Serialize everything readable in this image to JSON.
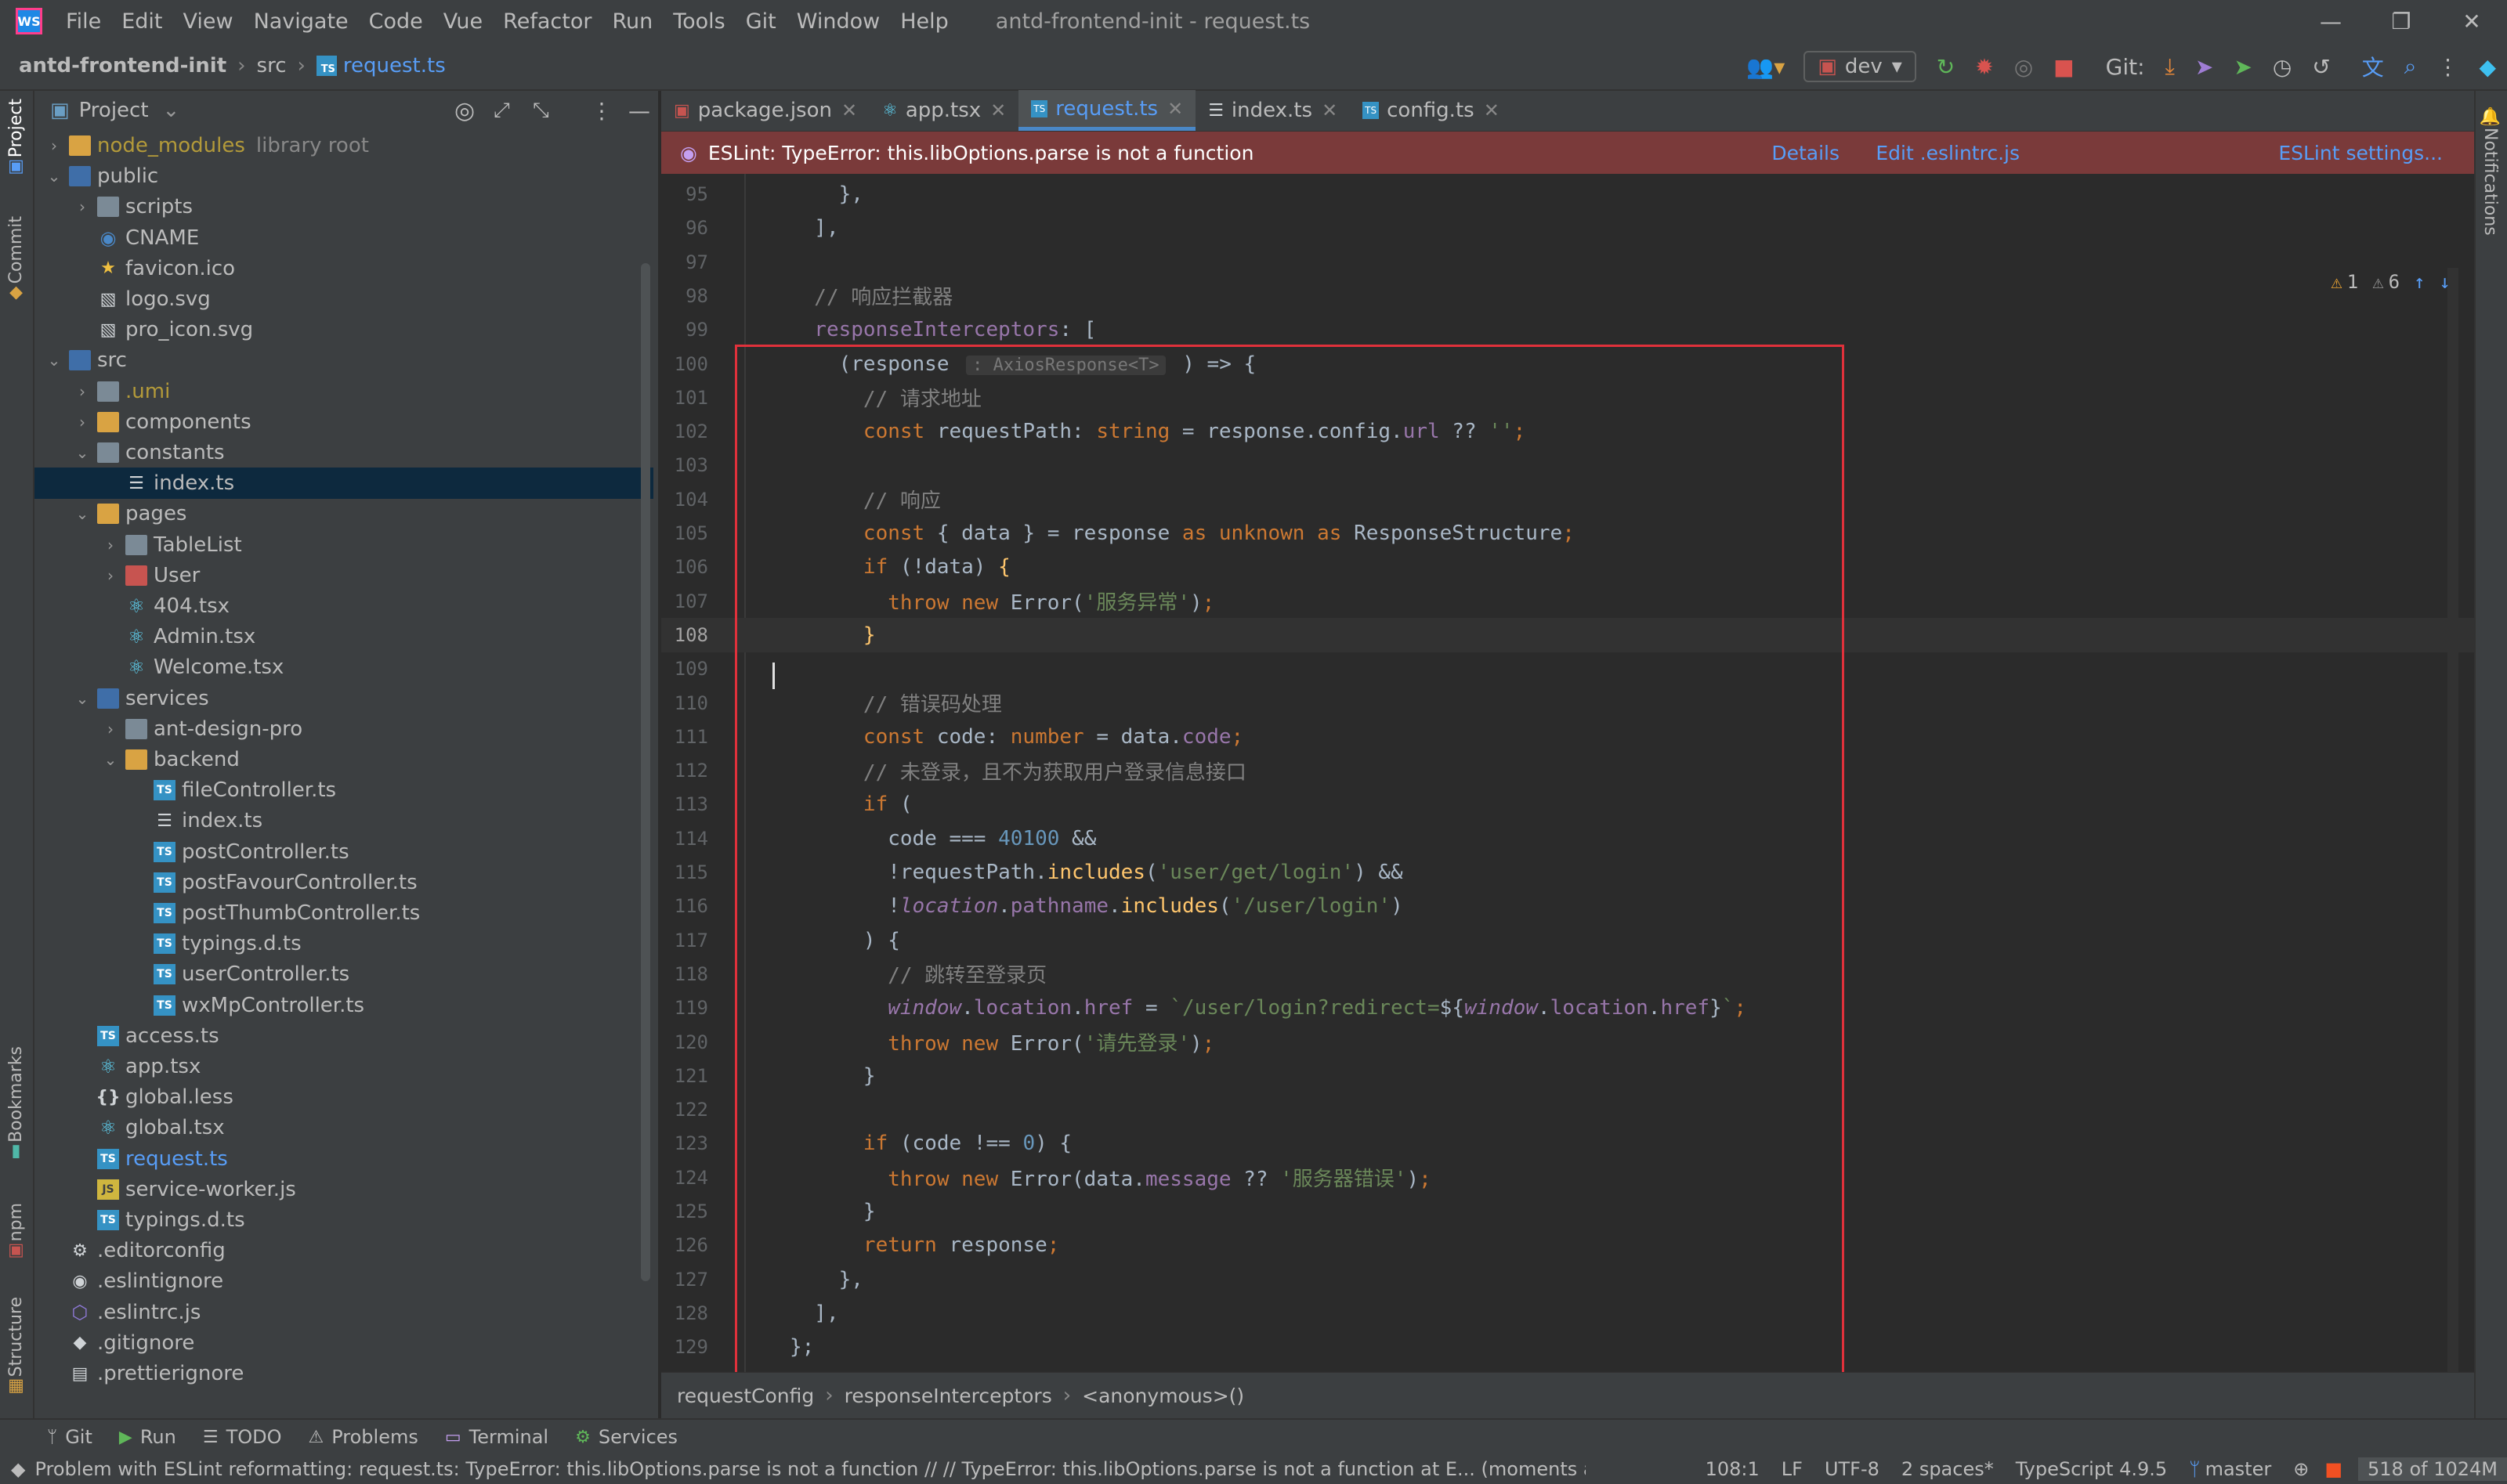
{
  "window": {
    "title": "antd-frontend-init - request.ts",
    "menu": [
      "File",
      "Edit",
      "View",
      "Navigate",
      "Code",
      "Vue",
      "Refactor",
      "Run",
      "Tools",
      "Git",
      "Window",
      "Help"
    ],
    "app_logo": "WS",
    "min": "—",
    "restore": "❐",
    "close": "✕"
  },
  "nav": {
    "crumbs": [
      "antd-frontend-init",
      "src",
      "request.ts"
    ],
    "branch": "dev",
    "git_label": "Git:"
  },
  "tool_strip": {
    "left": [
      "Project",
      "Commit",
      "Bookmarks",
      "npm",
      "Structure"
    ],
    "right": [
      "Notifications"
    ]
  },
  "project": {
    "title": "Project",
    "tree": [
      {
        "d": 1,
        "arrow": "›",
        "icon": "folder-yellow",
        "label": "node_modules",
        "extra": "library root",
        "style": "muted"
      },
      {
        "d": 1,
        "arrow": "⌄",
        "icon": "folder-blue",
        "label": "public"
      },
      {
        "d": 2,
        "arrow": "›",
        "icon": "folder",
        "label": "scripts"
      },
      {
        "d": 2,
        "arrow": "",
        "icon": "globe",
        "label": "CNAME"
      },
      {
        "d": 2,
        "arrow": "",
        "icon": "star",
        "label": "favicon.ico"
      },
      {
        "d": 2,
        "arrow": "",
        "icon": "image",
        "label": "logo.svg"
      },
      {
        "d": 2,
        "arrow": "",
        "icon": "image",
        "label": "pro_icon.svg"
      },
      {
        "d": 1,
        "arrow": "⌄",
        "icon": "folder-blue",
        "label": "src"
      },
      {
        "d": 2,
        "arrow": "›",
        "icon": "folder",
        "label": ".umi",
        "style": "muted"
      },
      {
        "d": 2,
        "arrow": "›",
        "icon": "folder-yellow",
        "label": "components"
      },
      {
        "d": 2,
        "arrow": "⌄",
        "icon": "folder",
        "label": "constants"
      },
      {
        "d": 3,
        "arrow": "",
        "icon": "list",
        "label": "index.ts",
        "selected": true
      },
      {
        "d": 2,
        "arrow": "⌄",
        "icon": "folder-yellow",
        "label": "pages"
      },
      {
        "d": 3,
        "arrow": "›",
        "icon": "folder",
        "label": "TableList"
      },
      {
        "d": 3,
        "arrow": "›",
        "icon": "folder-red",
        "label": "User"
      },
      {
        "d": 3,
        "arrow": "",
        "icon": "react",
        "label": "404.tsx"
      },
      {
        "d": 3,
        "arrow": "",
        "icon": "react",
        "label": "Admin.tsx"
      },
      {
        "d": 3,
        "arrow": "",
        "icon": "react",
        "label": "Welcome.tsx"
      },
      {
        "d": 2,
        "arrow": "⌄",
        "icon": "folder-blue",
        "label": "services"
      },
      {
        "d": 3,
        "arrow": "›",
        "icon": "folder",
        "label": "ant-design-pro"
      },
      {
        "d": 3,
        "arrow": "⌄",
        "icon": "folder-yellow",
        "label": "backend"
      },
      {
        "d": 4,
        "arrow": "",
        "icon": "ts",
        "label": "fileController.ts"
      },
      {
        "d": 4,
        "arrow": "",
        "icon": "list",
        "label": "index.ts"
      },
      {
        "d": 4,
        "arrow": "",
        "icon": "ts",
        "label": "postController.ts"
      },
      {
        "d": 4,
        "arrow": "",
        "icon": "ts",
        "label": "postFavourController.ts"
      },
      {
        "d": 4,
        "arrow": "",
        "icon": "ts",
        "label": "postThumbController.ts"
      },
      {
        "d": 4,
        "arrow": "",
        "icon": "ts",
        "label": "typings.d.ts"
      },
      {
        "d": 4,
        "arrow": "",
        "icon": "ts",
        "label": "userController.ts"
      },
      {
        "d": 4,
        "arrow": "",
        "icon": "ts",
        "label": "wxMpController.ts"
      },
      {
        "d": 2,
        "arrow": "",
        "icon": "ts",
        "label": "access.ts"
      },
      {
        "d": 2,
        "arrow": "",
        "icon": "react",
        "label": "app.tsx"
      },
      {
        "d": 2,
        "arrow": "",
        "icon": "less",
        "label": "global.less"
      },
      {
        "d": 2,
        "arrow": "",
        "icon": "react",
        "label": "global.tsx"
      },
      {
        "d": 2,
        "arrow": "",
        "icon": "ts",
        "label": "request.ts",
        "style": "blue"
      },
      {
        "d": 2,
        "arrow": "",
        "icon": "js",
        "label": "service-worker.js"
      },
      {
        "d": 2,
        "arrow": "",
        "icon": "ts",
        "label": "typings.d.ts"
      },
      {
        "d": 1,
        "arrow": "",
        "icon": "gear",
        "label": ".editorconfig"
      },
      {
        "d": 1,
        "arrow": "",
        "icon": "circle",
        "label": ".eslintignore"
      },
      {
        "d": 1,
        "arrow": "",
        "icon": "eslint",
        "label": ".eslintrc.js"
      },
      {
        "d": 1,
        "arrow": "",
        "icon": "diamond",
        "label": ".gitignore"
      },
      {
        "d": 1,
        "arrow": "",
        "icon": "doc",
        "label": ".prettierignore"
      }
    ]
  },
  "tabs": [
    {
      "icon": "package-icon",
      "label": "package.json"
    },
    {
      "icon": "react-icon",
      "label": "app.tsx"
    },
    {
      "icon": "ts-icon",
      "label": "request.ts",
      "active": true
    },
    {
      "icon": "list-icon",
      "label": "index.ts"
    },
    {
      "icon": "ts-icon",
      "label": "config.ts"
    }
  ],
  "eslint": {
    "message": "ESLint: TypeError: this.libOptions.parse is not a function",
    "links": [
      "Details",
      "Edit .eslintrc.js",
      "ESLint settings..."
    ]
  },
  "inspections": {
    "warn": "1",
    "weak": "6"
  },
  "code": {
    "current_line": "108",
    "lines": [
      {
        "n": "95",
        "t": [
          [
            "c",
            "    },"
          ]
        ]
      },
      {
        "n": "96",
        "t": [
          [
            "c",
            "  ],"
          ]
        ]
      },
      {
        "n": "97",
        "t": []
      },
      {
        "n": "98",
        "t": [
          [
            "cmt",
            "  // 响应拦截器"
          ]
        ]
      },
      {
        "n": "99",
        "t": [
          [
            "prop",
            "  responseInterceptors"
          ],
          [
            "c",
            ": ["
          ]
        ]
      },
      {
        "n": "100",
        "t": [
          [
            "c",
            "    (response "
          ],
          [
            "hint",
            ": AxiosResponse<T>"
          ],
          [
            "c",
            " ) => {"
          ]
        ]
      },
      {
        "n": "101",
        "t": [
          [
            "cmt",
            "      // 请求地址"
          ]
        ]
      },
      {
        "n": "102",
        "t": [
          [
            "kw",
            "      const "
          ],
          [
            "c",
            "requestPath: "
          ],
          [
            "kw",
            "string"
          ],
          [
            "c",
            " = response.config."
          ],
          [
            "prop",
            "url"
          ],
          [
            "c",
            " ?? "
          ],
          [
            "str",
            "''"
          ],
          [
            "kw",
            ";"
          ]
        ]
      },
      {
        "n": "103",
        "t": []
      },
      {
        "n": "104",
        "t": [
          [
            "cmt",
            "      // 响应"
          ]
        ]
      },
      {
        "n": "105",
        "t": [
          [
            "kw",
            "      const "
          ],
          [
            "c",
            "{ data } = response "
          ],
          [
            "kw",
            "as unknown as "
          ],
          [
            "c",
            "ResponseStructure"
          ],
          [
            "kw",
            ";"
          ]
        ]
      },
      {
        "n": "106",
        "t": [
          [
            "kw",
            "      if "
          ],
          [
            "c",
            "(!data) "
          ],
          [
            "fn",
            "{"
          ]
        ]
      },
      {
        "n": "107",
        "t": [
          [
            "kw",
            "        throw new "
          ],
          [
            "c",
            "Error("
          ],
          [
            "str",
            "'服务异常'"
          ],
          [
            "c",
            ")"
          ],
          [
            "kw",
            ";"
          ]
        ]
      },
      {
        "n": "108",
        "t": [
          [
            "fn",
            "      }"
          ]
        ]
      },
      {
        "n": "109",
        "t": []
      },
      {
        "n": "110",
        "t": [
          [
            "cmt",
            "      // 错误码处理"
          ]
        ]
      },
      {
        "n": "111",
        "t": [
          [
            "kw",
            "      const "
          ],
          [
            "c",
            "code: "
          ],
          [
            "kw",
            "number"
          ],
          [
            "c",
            " = data."
          ],
          [
            "prop",
            "code"
          ],
          [
            "kw",
            ";"
          ]
        ]
      },
      {
        "n": "112",
        "t": [
          [
            "cmt",
            "      // 未登录，且不为获取用户登录信息接口"
          ]
        ]
      },
      {
        "n": "113",
        "t": [
          [
            "kw",
            "      if "
          ],
          [
            "c",
            "("
          ]
        ]
      },
      {
        "n": "114",
        "t": [
          [
            "c",
            "        code === "
          ],
          [
            "num",
            "40100"
          ],
          [
            "c",
            " &&"
          ]
        ]
      },
      {
        "n": "115",
        "t": [
          [
            "c",
            "        !requestPath."
          ],
          [
            "fn",
            "includes"
          ],
          [
            "c",
            "("
          ],
          [
            "str",
            "'user/get/login'"
          ],
          [
            "c",
            ") &&"
          ]
        ]
      },
      {
        "n": "116",
        "t": [
          [
            "c",
            "        !"
          ],
          [
            "glob",
            "location"
          ],
          [
            "c",
            "."
          ],
          [
            "prop",
            "pathname"
          ],
          [
            "c",
            "."
          ],
          [
            "fn",
            "includes"
          ],
          [
            "c",
            "("
          ],
          [
            "str",
            "'/user/login'"
          ],
          [
            "c",
            ")"
          ]
        ]
      },
      {
        "n": "117",
        "t": [
          [
            "c",
            "      ) {"
          ]
        ]
      },
      {
        "n": "118",
        "t": [
          [
            "cmt",
            "        // 跳转至登录页"
          ]
        ]
      },
      {
        "n": "119",
        "t": [
          [
            "glob",
            "        window"
          ],
          [
            "c",
            "."
          ],
          [
            "prop",
            "location"
          ],
          [
            "c",
            "."
          ],
          [
            "prop",
            "href"
          ],
          [
            "c",
            " = "
          ],
          [
            "str",
            "`/user/login?redirect="
          ],
          [
            "c",
            "${"
          ],
          [
            "glob",
            "window"
          ],
          [
            "c",
            "."
          ],
          [
            "prop",
            "location"
          ],
          [
            "c",
            "."
          ],
          [
            "prop",
            "href"
          ],
          [
            "c",
            "}"
          ],
          [
            "str",
            "`"
          ],
          [
            "kw",
            ";"
          ]
        ]
      },
      {
        "n": "120",
        "t": [
          [
            "kw",
            "        throw new "
          ],
          [
            "c",
            "Error("
          ],
          [
            "str",
            "'请先登录'"
          ],
          [
            "c",
            ")"
          ],
          [
            "kw",
            ";"
          ]
        ]
      },
      {
        "n": "121",
        "t": [
          [
            "c",
            "      }"
          ]
        ]
      },
      {
        "n": "122",
        "t": []
      },
      {
        "n": "123",
        "t": [
          [
            "kw",
            "      if "
          ],
          [
            "c",
            "(code !== "
          ],
          [
            "num",
            "0"
          ],
          [
            "c",
            ") {"
          ]
        ]
      },
      {
        "n": "124",
        "t": [
          [
            "kw",
            "        throw new "
          ],
          [
            "c",
            "Error(data."
          ],
          [
            "prop",
            "message"
          ],
          [
            "c",
            " ?? "
          ],
          [
            "str",
            "'服务器错误'"
          ],
          [
            "c",
            ")"
          ],
          [
            "kw",
            ";"
          ]
        ]
      },
      {
        "n": "125",
        "t": [
          [
            "c",
            "      }"
          ]
        ]
      },
      {
        "n": "126",
        "t": [
          [
            "kw",
            "      return "
          ],
          [
            "c",
            "response"
          ],
          [
            "kw",
            ";"
          ]
        ]
      },
      {
        "n": "127",
        "t": [
          [
            "c",
            "    },"
          ]
        ]
      },
      {
        "n": "128",
        "t": [
          [
            "c",
            "  ],"
          ]
        ]
      },
      {
        "n": "129",
        "t": [
          [
            "c",
            "};"
          ]
        ]
      }
    ]
  },
  "editor_breadcrumb": [
    "requestConfig",
    "responseInterceptors",
    "<anonymous>()"
  ],
  "toolwindows": [
    {
      "icon": "git-icon",
      "label": "Git"
    },
    {
      "icon": "run-icon",
      "label": "Run"
    },
    {
      "icon": "todo-icon",
      "label": "TODO"
    },
    {
      "icon": "problems-icon",
      "label": "Problems"
    },
    {
      "icon": "terminal-icon",
      "label": "Terminal"
    },
    {
      "icon": "services-icon",
      "label": "Services"
    }
  ],
  "status": {
    "message": "Problem with ESLint reformatting: request.ts: TypeError: this.libOptions.parse is not a function // // TypeError: this.libOptions.parse is not a function     at E... (moments ago)",
    "position": "108:1",
    "line_sep": "LF",
    "encoding": "UTF-8",
    "indent": "2 spaces*",
    "language": "TypeScript 4.9.5",
    "vcs_branch": "master",
    "memory": "518 of 1024M"
  }
}
